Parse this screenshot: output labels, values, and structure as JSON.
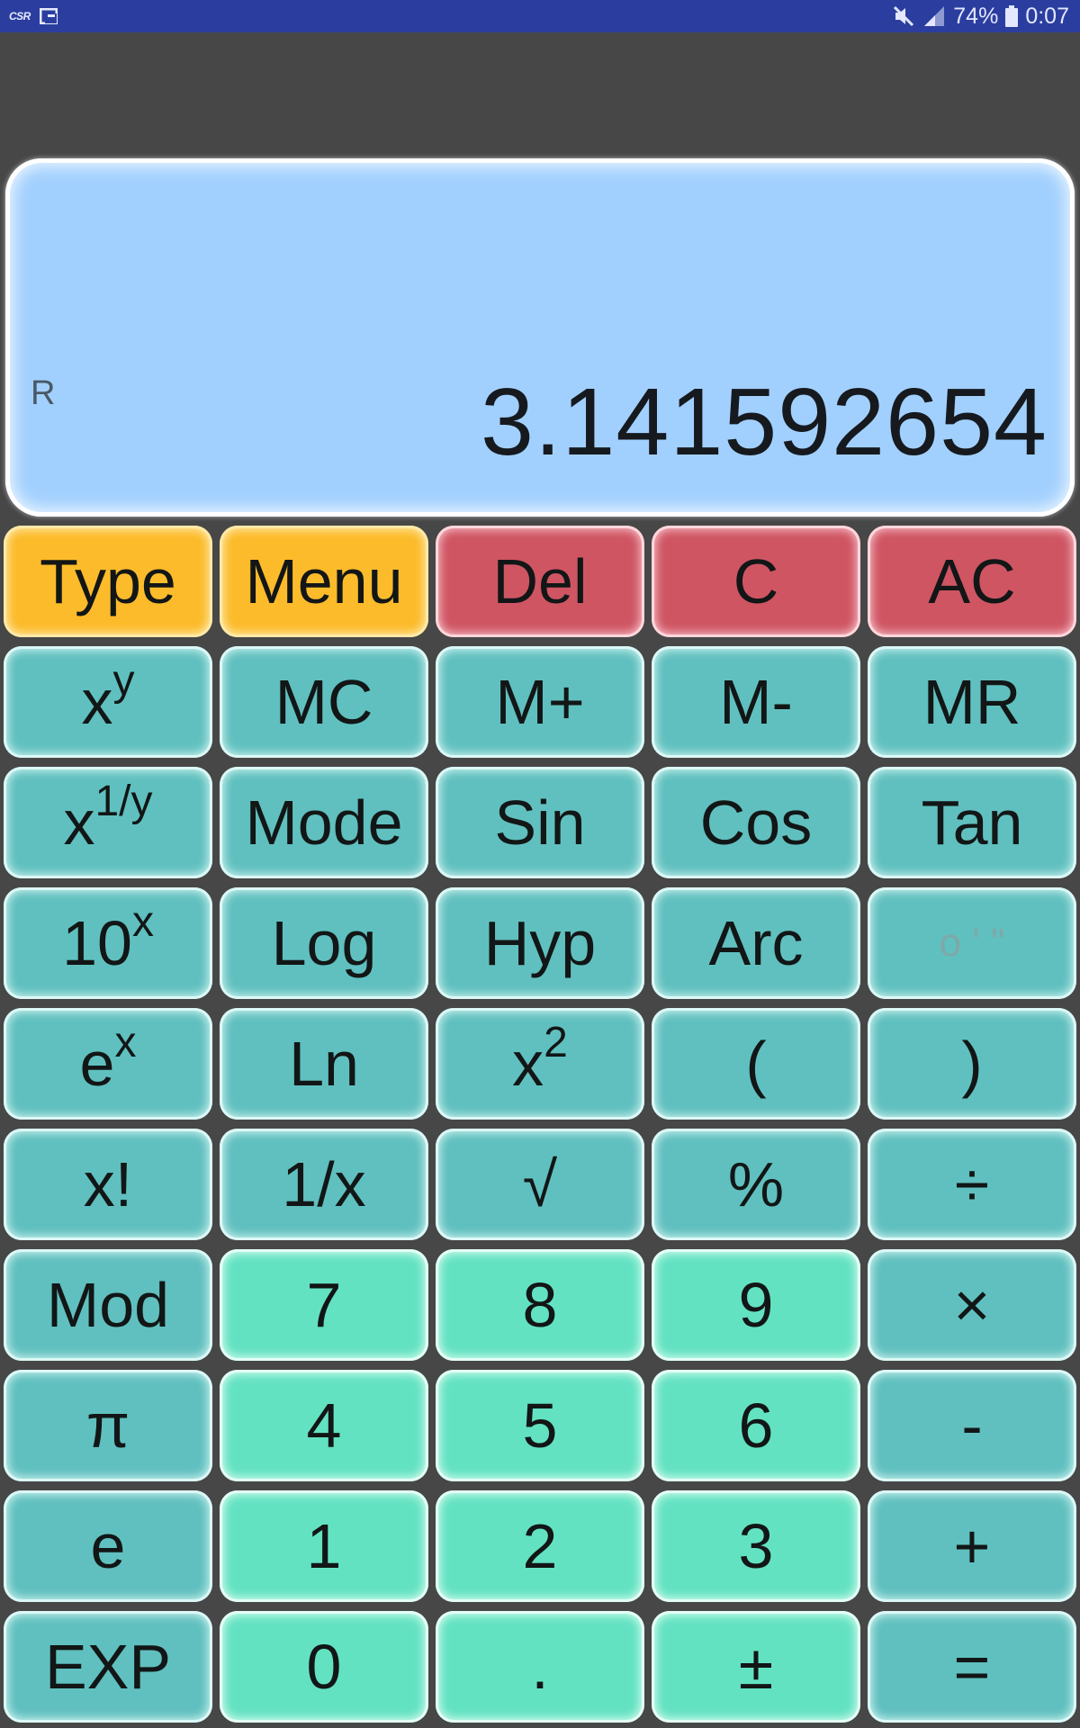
{
  "status_bar": {
    "left_icon_text": "CSR",
    "battery_percent": "74%",
    "time": "0:07",
    "icons": [
      "csr-app-icon",
      "notification-icon",
      "mute-icon",
      "signal-icon",
      "battery-icon"
    ]
  },
  "display": {
    "angle_mode": "R",
    "value": "3.141592654",
    "background_color": "#a2d0fe"
  },
  "colors": {
    "orange": "#fcbb2a",
    "red": "#cf5563",
    "teal": "#60c0bf",
    "mint": "#63e2c2",
    "status_bar": "#2b3e9f",
    "background": "#474747"
  },
  "keys": {
    "type": "Type",
    "menu": "Menu",
    "del": "Del",
    "c": "C",
    "ac": "AC",
    "power_base": "x",
    "power_exp": "y",
    "mc": "MC",
    "m_plus": "M+",
    "m_minus": "M-",
    "mr": "MR",
    "root_base": "x",
    "root_exp": "1/y",
    "mode": "Mode",
    "sin": "Sin",
    "cos": "Cos",
    "tan": "Tan",
    "ten_pow_base": "10",
    "ten_pow_exp": "x",
    "log": "Log",
    "hyp": "Hyp",
    "arc": "Arc",
    "dms": "o ' \"",
    "exp_base": "e",
    "exp_exp": "x",
    "ln": "Ln",
    "square_base": "x",
    "square_exp": "2",
    "open_paren": "(",
    "close_paren": ")",
    "factorial": "x!",
    "reciprocal": "1/x",
    "sqrt": "√",
    "percent": "%",
    "divide": "÷",
    "mod": "Mod",
    "seven": "7",
    "eight": "8",
    "nine": "9",
    "multiply": "×",
    "pi": "π",
    "four": "4",
    "five": "5",
    "six": "6",
    "minus": "-",
    "e_const": "e",
    "one": "1",
    "two": "2",
    "three": "3",
    "plus": "+",
    "exp_key": "EXP",
    "zero": "0",
    "decimal": ".",
    "plus_minus": "±",
    "equals": "="
  }
}
